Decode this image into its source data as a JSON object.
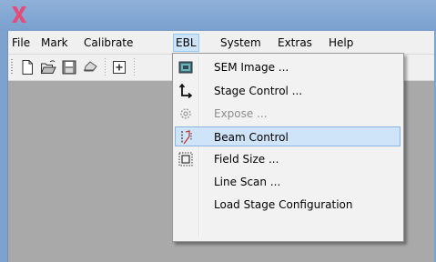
{
  "menubar": {
    "items": [
      "File",
      "Mark",
      "Calibrate",
      "EBL",
      "System",
      "Extras",
      "Help"
    ],
    "active": "EBL"
  },
  "toolbar": {
    "buttons": [
      "new-document-icon",
      "open-folder-icon",
      "save-disk-icon",
      "print-icon",
      "add-item-icon"
    ]
  },
  "ebl_menu": {
    "items": [
      {
        "label": "SEM Image ...",
        "icon": "sem-image-icon",
        "enabled": true
      },
      {
        "label": "Stage Control ...",
        "icon": "stage-control-icon",
        "enabled": true
      },
      {
        "label": "Expose ...",
        "icon": "expose-gear-icon",
        "enabled": false
      },
      {
        "label": "Beam Control",
        "icon": "beam-control-icon",
        "enabled": true,
        "highlighted": true
      },
      {
        "label": "Field Size ...",
        "icon": "field-size-icon",
        "enabled": true
      },
      {
        "label": "Line Scan ...",
        "icon": "",
        "enabled": true
      },
      {
        "label": "Load Stage Configuration",
        "icon": "",
        "enabled": true
      }
    ]
  },
  "colors": {
    "titlebar": "#7da2ce",
    "client_area": "#a9a9a9",
    "menu_highlight": "#cfe4f9",
    "logo": "#e34d7b"
  }
}
